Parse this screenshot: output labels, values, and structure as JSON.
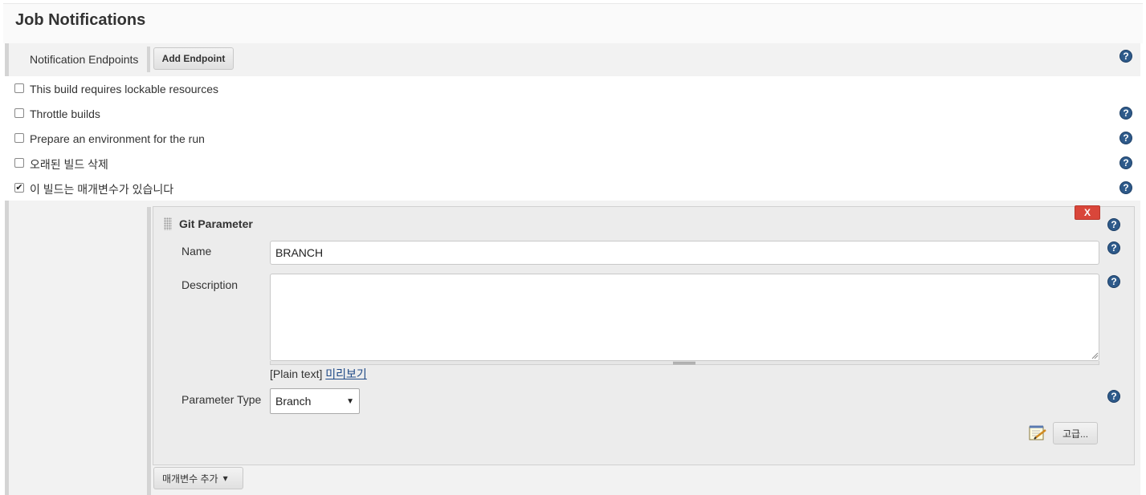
{
  "section": {
    "title": "Job Notifications"
  },
  "notification": {
    "label": "Notification Endpoints",
    "add_button": "Add Endpoint"
  },
  "options": [
    {
      "label": "This build requires lockable resources",
      "checked": false,
      "help": false
    },
    {
      "label": "Throttle builds",
      "checked": false,
      "help": true
    },
    {
      "label": "Prepare an environment for the run",
      "checked": false,
      "help": true
    },
    {
      "label": "오래된 빌드 삭제",
      "checked": false,
      "help": true
    },
    {
      "label": "이 빌드는 매개변수가 있습니다",
      "checked": true,
      "help": true
    }
  ],
  "git_parameter": {
    "title": "Git Parameter",
    "delete_label": "X",
    "name_label": "Name",
    "name_value": "BRANCH",
    "description_label": "Description",
    "description_value": "",
    "plain_text": "[Plain text]",
    "preview_link": "미리보기",
    "type_label": "Parameter Type",
    "type_value": "Branch",
    "advanced_button": "고급..."
  },
  "add_parameter_button": "매개변수 추가",
  "icons": {
    "help": "help-icon",
    "checkmark": "✔",
    "help_glyph": "?",
    "dropdown": "▼",
    "caret": "▾"
  },
  "colors": {
    "help": "#2e5a8a",
    "delete": "#d9463a",
    "link": "#204a87"
  }
}
